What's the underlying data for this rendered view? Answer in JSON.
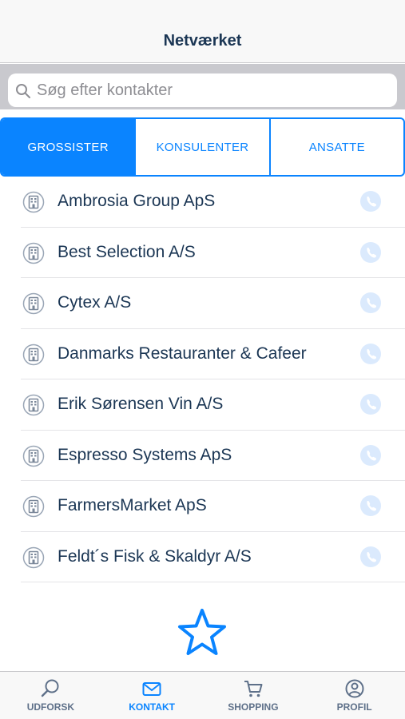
{
  "header": {
    "title": "Netværket"
  },
  "search": {
    "placeholder": "Søg efter kontakter",
    "value": ""
  },
  "segments": [
    {
      "label": "GROSSISTER",
      "active": true
    },
    {
      "label": "KONSULENTER",
      "active": false
    },
    {
      "label": "ANSATTE",
      "active": false
    }
  ],
  "contacts": [
    {
      "name": "Ambrosia Group ApS"
    },
    {
      "name": "Best Selection A/S"
    },
    {
      "name": "Cytex A/S"
    },
    {
      "name": "Danmarks Restauranter & Cafeer"
    },
    {
      "name": "Erik Sørensen Vin A/S"
    },
    {
      "name": "Espresso Systems ApS"
    },
    {
      "name": "FarmersMarket ApS"
    },
    {
      "name": "Feldt´s Fisk & Skaldyr A/S"
    }
  ],
  "icons": {
    "row": "building-icon",
    "action": "phone-icon",
    "favorite": "star-icon"
  },
  "tabbar": {
    "items": [
      {
        "label": "UDFORSK",
        "icon": "search-icon",
        "active": false
      },
      {
        "label": "KONTAKT",
        "icon": "mail-icon",
        "active": true
      },
      {
        "label": "SHOPPING",
        "icon": "cart-icon",
        "active": false
      },
      {
        "label": "PROFIL",
        "icon": "profile-icon",
        "active": false
      }
    ]
  },
  "colors": {
    "accent": "#0a84ff",
    "text": "#1b3654",
    "phone": "#dbeafd",
    "tab_inactive": "#5e7089"
  }
}
